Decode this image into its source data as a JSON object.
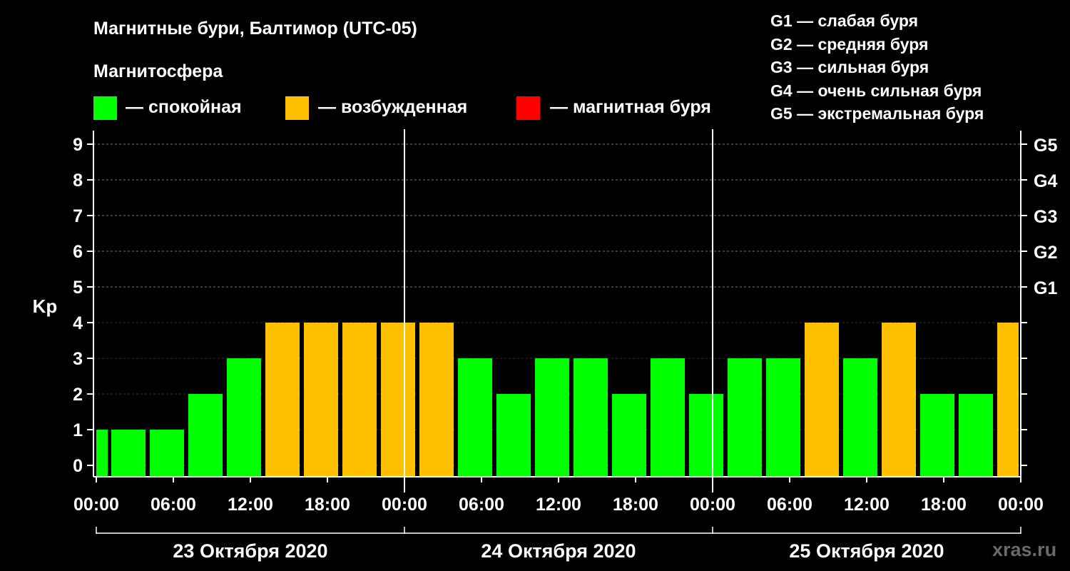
{
  "title": "Магнитные бури, Балтимор (UTC-05)",
  "subtitle": "Магнитосфера",
  "legend": [
    {
      "label": "— спокойная",
      "color": "#00ff00"
    },
    {
      "label": "— возбужденная",
      "color": "#ffc000"
    },
    {
      "label": "— магнитная буря",
      "color": "#ff0000"
    }
  ],
  "g_scale": [
    "G1 — слабая буря",
    "G2 — средняя буря",
    "G3 — сильная буря",
    "G4 — очень сильная буря",
    "G5 — экстремальная буря"
  ],
  "watermark": "xras.ru",
  "chart_data": {
    "type": "bar",
    "ylabel": "Kp",
    "ylim": [
      0,
      9
    ],
    "y_ticks": [
      "0",
      "1",
      "2",
      "3",
      "4",
      "5",
      "6",
      "7",
      "8",
      "9"
    ],
    "right_ticks": [
      {
        "value": 5,
        "label": "G1"
      },
      {
        "value": 6,
        "label": "G2"
      },
      {
        "value": 7,
        "label": "G3"
      },
      {
        "value": 8,
        "label": "G4"
      },
      {
        "value": 9,
        "label": "G5"
      }
    ],
    "grid": true,
    "x_tick_labels": [
      "00:00",
      "06:00",
      "12:00",
      "18:00",
      "00:00",
      "06:00",
      "12:00",
      "18:00",
      "00:00",
      "06:00",
      "12:00",
      "18:00",
      "00:00"
    ],
    "days": [
      "23 Октября 2020",
      "24 Октября 2020",
      "25 Октября 2020"
    ],
    "hours_span": 72,
    "values": [
      1,
      1,
      1,
      2,
      3,
      4,
      4,
      4,
      4,
      4,
      3,
      2,
      3,
      3,
      2,
      3,
      2,
      3,
      3,
      4,
      3,
      4,
      2,
      2,
      4
    ],
    "colors": {
      "quiet": "#00ff00",
      "active": "#ffc000",
      "storm": "#ff0000"
    }
  }
}
